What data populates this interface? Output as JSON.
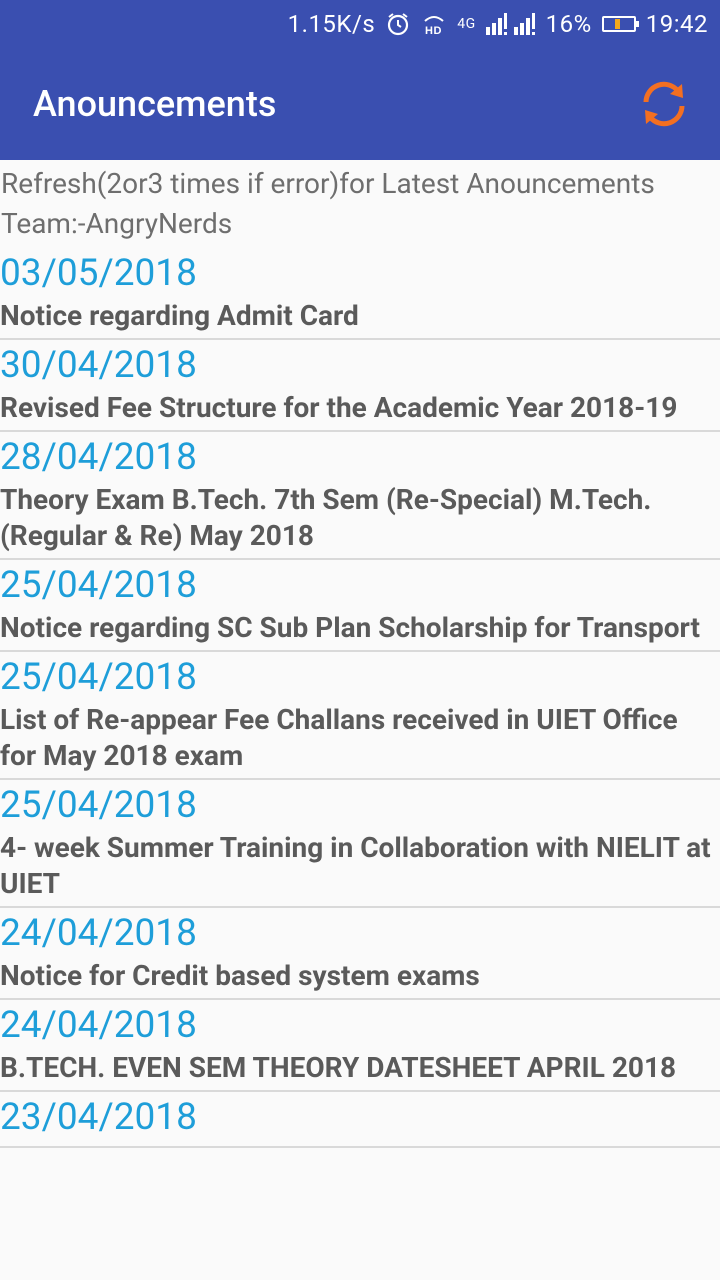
{
  "status_bar": {
    "speed": "1.15K/s",
    "network": "4G",
    "battery": "16%",
    "time": "19:42",
    "icons": [
      "alarm-icon",
      "hd-icon",
      "signal-icon",
      "battery-icon"
    ]
  },
  "app_bar": {
    "title": "Anouncements",
    "refresh_icon": "refresh-icon",
    "accent": "#f36f21",
    "background": "#3a4fb0"
  },
  "intro": {
    "line1": "Refresh(2or3 times if error)for Latest Anouncements",
    "line2": "Team:-AngryNerds"
  },
  "announcements": [
    {
      "date": "03/05/2018",
      "title": " Notice regarding Admit Card"
    },
    {
      "date": "30/04/2018",
      "title": " Revised Fee Structure for the Academic Year 2018-19"
    },
    {
      "date": "28/04/2018",
      "title": " Theory Exam B.Tech. 7th Sem (Re-Special) M.Tech. (Regular & Re) May 2018"
    },
    {
      "date": "25/04/2018",
      "title": " Notice regarding SC Sub Plan Scholarship for Transport"
    },
    {
      "date": "25/04/2018",
      "title": " List of Re-appear Fee Challans received in UIET Office for May 2018 exam"
    },
    {
      "date": "25/04/2018",
      "title": " 4- week Summer Training in Collaboration with NIELIT at UIET"
    },
    {
      "date": "24/04/2018",
      "title": " Notice for Credit based system exams"
    },
    {
      "date": "24/04/2018",
      "title": " B.TECH. EVEN SEM THEORY DATESHEET APRIL 2018"
    },
    {
      "date": "23/04/2018",
      "title": ""
    }
  ]
}
